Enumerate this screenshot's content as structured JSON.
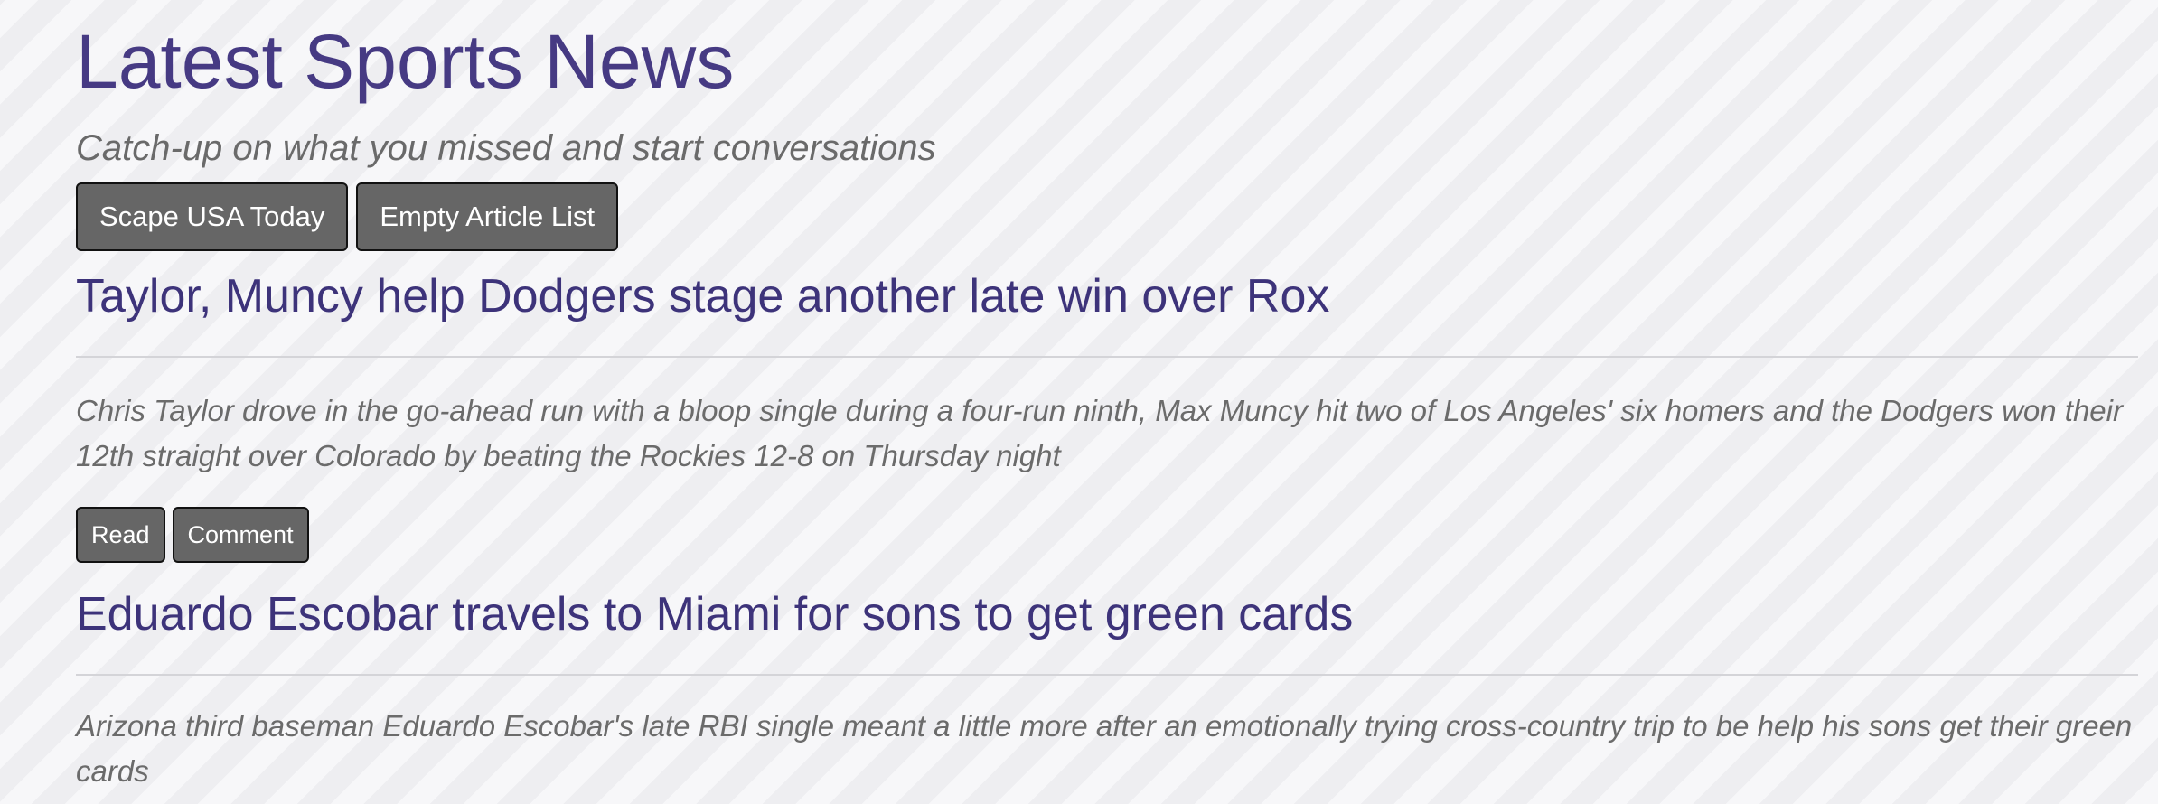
{
  "header": {
    "title": "Latest Sports News",
    "subtitle": "Catch-up on what you missed and start conversations"
  },
  "toolbar": {
    "scrape_label": "Scape USA Today",
    "empty_label": "Empty Article List"
  },
  "articles": [
    {
      "title": "Taylor, Muncy help Dodgers stage another late win over Rox",
      "summary": "Chris Taylor drove in the go-ahead run with a bloop single during a four-run ninth, Max Muncy hit two of Los Angeles' six homers and the Dodgers won their 12th straight over Colorado by beating the Rockies 12-8 on Thursday night",
      "read_label": "Read",
      "comment_label": "Comment"
    },
    {
      "title": "Eduardo Escobar travels to Miami for sons to get green cards",
      "summary": "Arizona third baseman Eduardo Escobar's late RBI single meant a little more after an emotionally trying cross-country trip to be help his sons get their green cards"
    }
  ]
}
